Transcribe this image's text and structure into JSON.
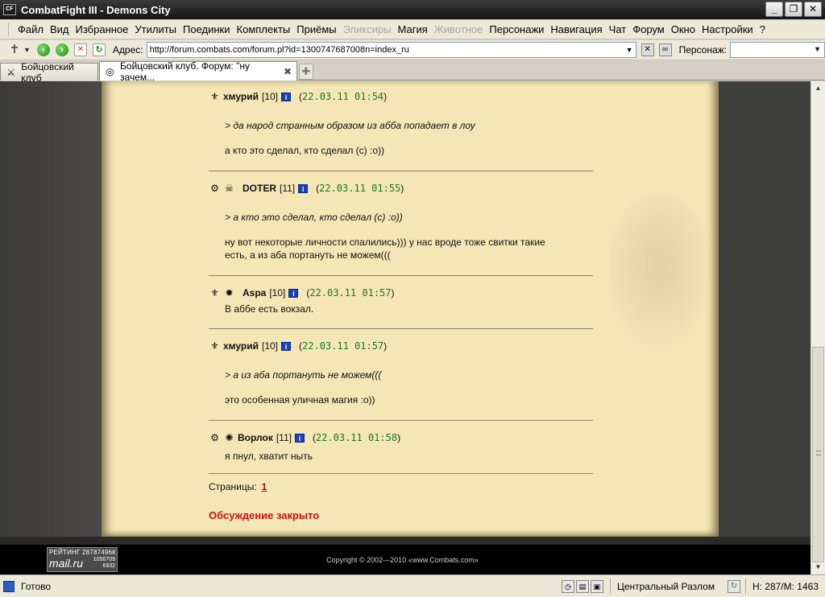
{
  "window": {
    "title": "CombatFight III - Demons City",
    "app_icon": "CF",
    "controls": [
      "_",
      "❐",
      "✕"
    ]
  },
  "menu": [
    {
      "label": "Файл",
      "disabled": false
    },
    {
      "label": "Вид",
      "disabled": false
    },
    {
      "label": "Избранное",
      "disabled": false
    },
    {
      "label": "Утилиты",
      "disabled": false
    },
    {
      "label": "Поединки",
      "disabled": false
    },
    {
      "label": "Комплекты",
      "disabled": false
    },
    {
      "label": "Приёмы",
      "disabled": false
    },
    {
      "label": "Эликсиры",
      "disabled": true
    },
    {
      "label": "Магия",
      "disabled": false
    },
    {
      "label": "Животное",
      "disabled": true
    },
    {
      "label": "Персонажи",
      "disabled": false
    },
    {
      "label": "Навигация",
      "disabled": false
    },
    {
      "label": "Чат",
      "disabled": false
    },
    {
      "label": "Форум",
      "disabled": false
    },
    {
      "label": "Окно",
      "disabled": false
    },
    {
      "label": "Настройки",
      "disabled": false
    },
    {
      "label": "?",
      "disabled": false
    }
  ],
  "toolbar": {
    "address_label": "Адрес:",
    "address_value": "http://forum.combats.com/forum.pl?id=1300747687008n=index_ru",
    "person_label": "Персонаж:",
    "person_value": ""
  },
  "tabs": [
    {
      "label": "Бойцовский клуб",
      "active": false
    },
    {
      "label": "Бойцовский клуб. Форум: \"ну зачем...",
      "active": true
    }
  ],
  "posts": [
    {
      "user": "хмурий",
      "level": "[10]",
      "date": "22.03.11 01:54",
      "badges": [
        "clan-icon"
      ],
      "quote": "> да народ странным образом из абба попадает в лоу",
      "text": [
        "а кто это сделал, кто сделал (с) :о))"
      ]
    },
    {
      "user": "DOTER",
      "level": "[11]",
      "date": "22.03.11 01:55",
      "badges": [
        "clan-icon",
        "mask-icon"
      ],
      "quote": "> а кто это сделал, кто сделал (с) :о))",
      "text": [
        "ну вот некоторые личности спалились))) у нас вроде тоже свитки такие",
        "есть, а из аба портануть не можем((("
      ]
    },
    {
      "user": "Aspa",
      "level": "[10]",
      "date": "22.03.11 01:57",
      "badges": [
        "clan-icon",
        "emblem-icon"
      ],
      "quote": "",
      "text": [
        "В аббе есть вокзал."
      ]
    },
    {
      "user": "хмурий",
      "level": "[10]",
      "date": "22.03.11 01:57",
      "badges": [
        "clan-icon"
      ],
      "quote": "> а из аба портануть не можем(((",
      "text": [
        "это особенная уличная магия :о))"
      ]
    },
    {
      "user": "Ворлок",
      "level": "[11]",
      "date": "22.03.11 01:58",
      "badges": [
        "clan-icon",
        "emblem-icon"
      ],
      "quote": "",
      "text": [
        "я пнул, хватит ныть"
      ]
    }
  ],
  "pagination": {
    "label": "Страницы:",
    "current": "1"
  },
  "closed_notice": "Обсуждение закрыто",
  "footer": {
    "rating_label": "РЕЙТИНГ 28787496К",
    "rating_brand": "mail.ru",
    "rating_num1": "1056709",
    "rating_num2": "6932",
    "copyright": "Copyright © 2002—2010 «www.Combats.com»"
  },
  "statusbar": {
    "status": "Готово",
    "location": "Центральный Разлом",
    "stats": "Н: 287/М: 1463"
  },
  "colors": {
    "parchment": "#f4e6b5",
    "date_green": "#1c7a1c",
    "closed_red": "#cc1111",
    "link_red": "#8b1a1a"
  }
}
